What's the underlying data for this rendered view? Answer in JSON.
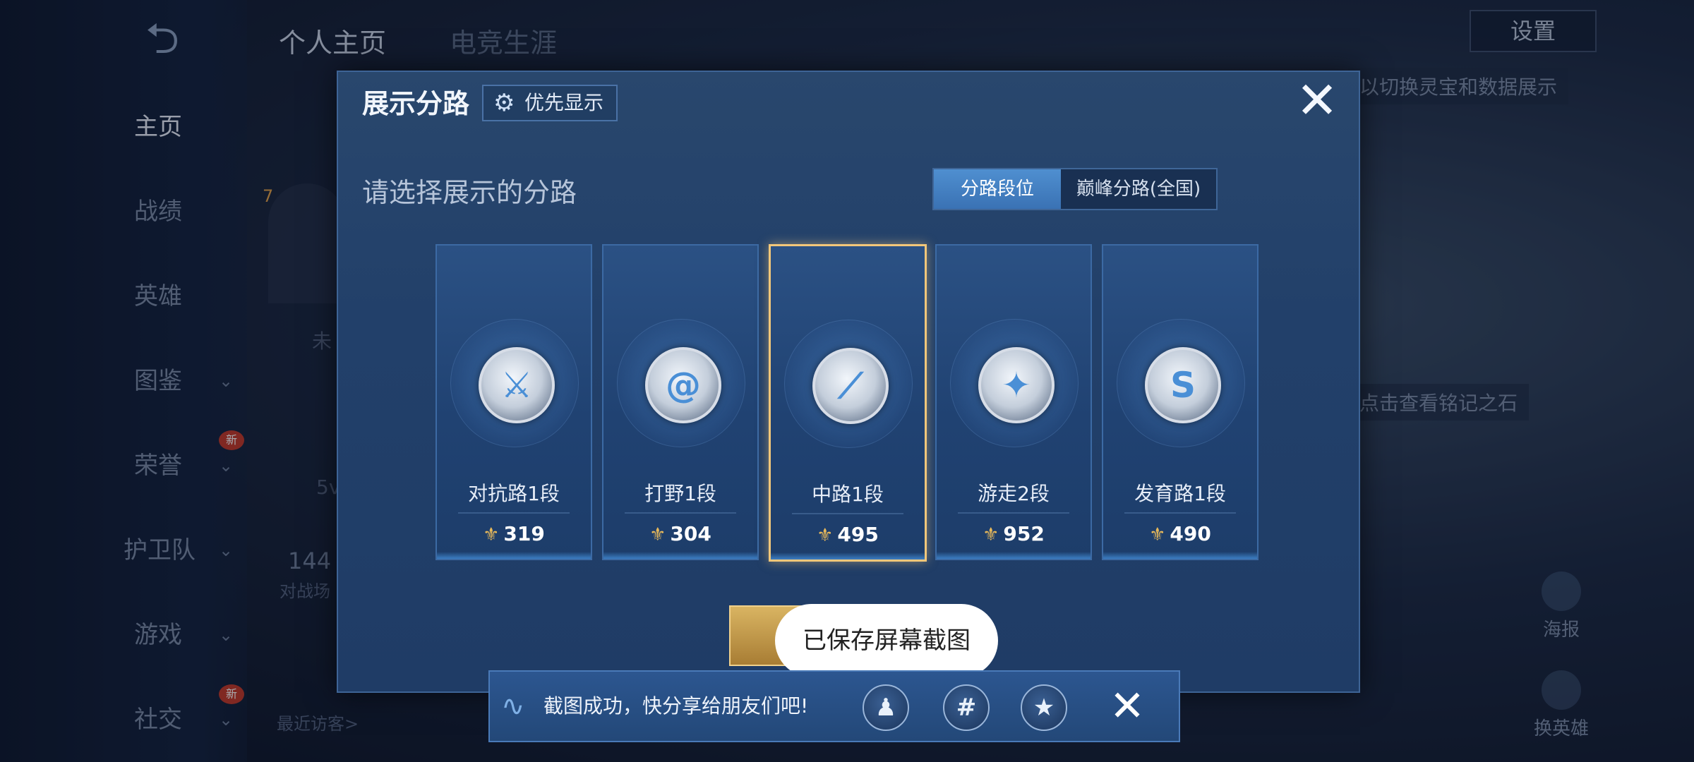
{
  "background": {
    "back_symbol": "⮌",
    "nav": [
      {
        "label": "主页",
        "chevron": false,
        "new": false,
        "active": true
      },
      {
        "label": "战绩",
        "chevron": false,
        "new": false,
        "active": false
      },
      {
        "label": "英雄",
        "chevron": false,
        "new": false,
        "active": false
      },
      {
        "label": "图鉴",
        "chevron": true,
        "new": false,
        "active": false
      },
      {
        "label": "荣誉",
        "chevron": true,
        "new": true,
        "active": false
      },
      {
        "label": "护卫队",
        "chevron": true,
        "new": false,
        "active": false
      },
      {
        "label": "游戏",
        "chevron": true,
        "new": false,
        "active": false
      },
      {
        "label": "社交",
        "chevron": true,
        "new": true,
        "active": false
      }
    ],
    "new_badge": "新",
    "chevron_symbol": "⌄",
    "tabs": [
      "个人主页",
      "电竞生涯"
    ],
    "settings_label": "设置",
    "hint_switch": "以切换灵宝和数据展示",
    "hint_stone": "点击查看铭记之石",
    "poster_label": "海报",
    "swap_hero_label": "换英雄",
    "visitors_label": "最近访客>",
    "count_fragment": "144",
    "battle_fragment": "对战场",
    "mode_fragment": "5v",
    "level_badge": "7",
    "status_fragment": "未"
  },
  "modal": {
    "title": "展示分路",
    "priority_label": "优先显示",
    "close_symbol": "✕",
    "subtitle": "请选择展示的分路",
    "segment": {
      "active": "分路段位",
      "inactive": "巅峰分路(全国)"
    },
    "lanes": [
      {
        "name": "对抗路1段",
        "score": "319",
        "glyph": "⚔",
        "selected": false
      },
      {
        "name": "打野1段",
        "score": "304",
        "glyph": "@",
        "selected": false
      },
      {
        "name": "中路1段",
        "score": "495",
        "glyph": "⟋",
        "selected": true
      },
      {
        "name": "游走2段",
        "score": "952",
        "glyph": "✦",
        "selected": false
      },
      {
        "name": "发育路1段",
        "score": "490",
        "glyph": "S",
        "selected": false
      }
    ],
    "score_mark": "⚜"
  },
  "toast": "已保存屏幕截图",
  "share": {
    "text": "截图成功，快分享给朋友们吧!",
    "icons": [
      {
        "name": "qq",
        "glyph": "♟"
      },
      {
        "name": "wechat-moments",
        "glyph": "#"
      },
      {
        "name": "qzone",
        "glyph": "★"
      }
    ],
    "close_symbol": "✕"
  }
}
